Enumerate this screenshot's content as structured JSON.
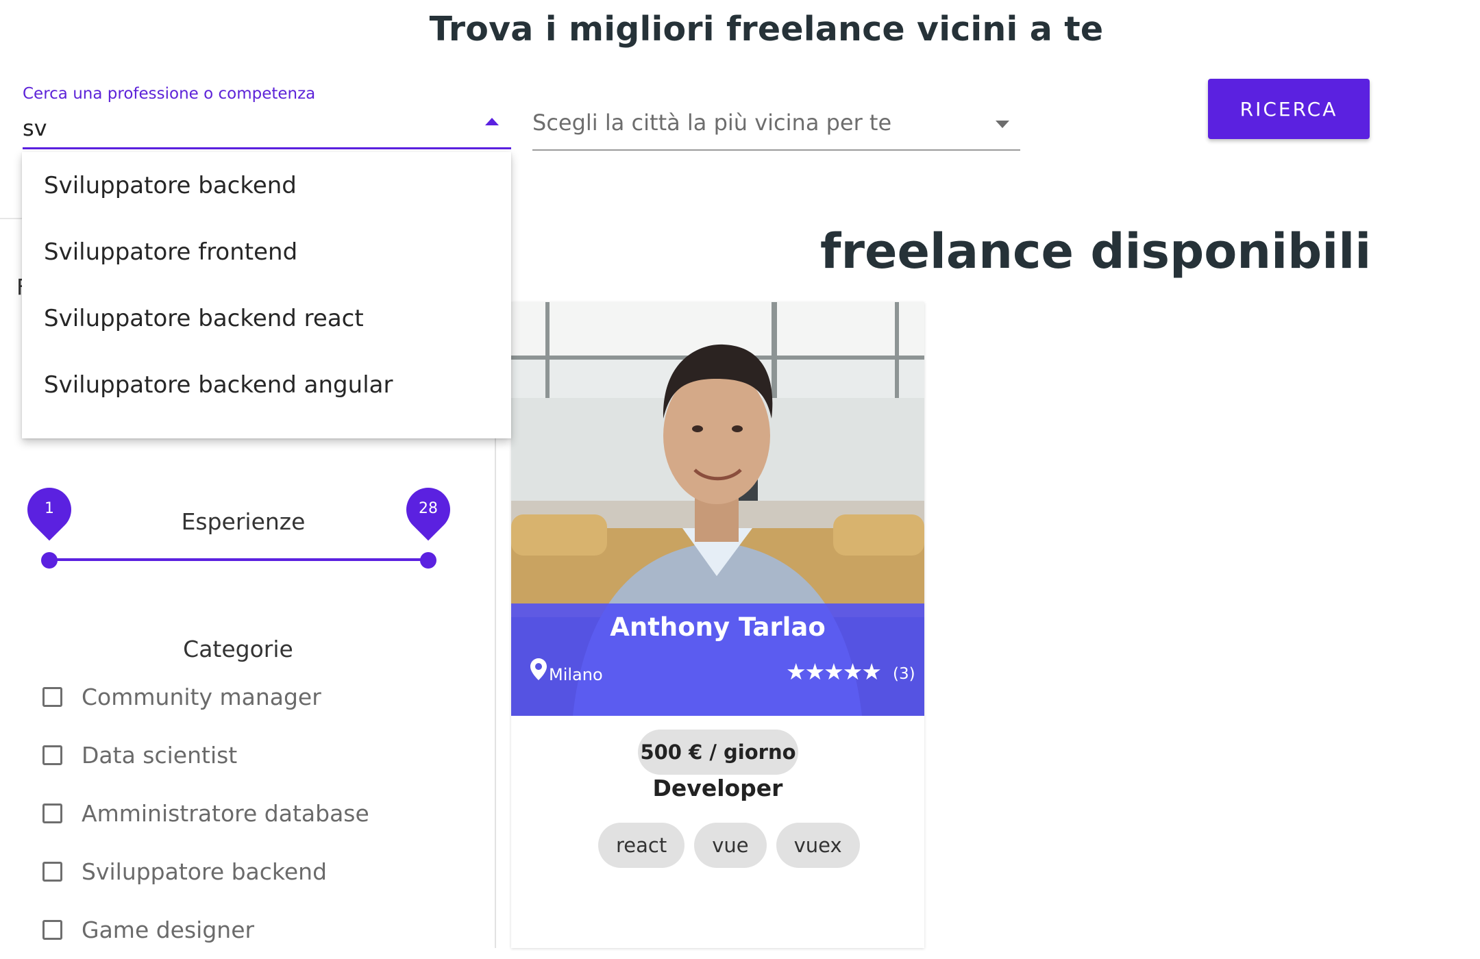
{
  "header": {
    "title": "Trova i migliori freelance vicini a te"
  },
  "search": {
    "job_label": "Cerca una professione o competenza",
    "job_value": "sv",
    "city_placeholder": "Scegli la città la più vicina per te",
    "button_label": "RICERCA",
    "suggestions": [
      "Sviluppatore backend",
      "Sviluppatore frontend",
      "Sviluppatore backend react",
      "Sviluppatore backend angular"
    ]
  },
  "filters": {
    "partial_heading": "F",
    "experience": {
      "label": "Esperienze",
      "min": "1",
      "max": "28"
    },
    "categories_title": "Categorie",
    "categories": [
      "Community manager",
      "Data scientist",
      "Amministratore database",
      "Sviluppatore backend",
      "Game designer"
    ]
  },
  "results": {
    "title": "freelance disponibili",
    "card": {
      "name": "Anthony Tarlao",
      "city": "Milano",
      "stars": "★★★★★",
      "rating_count": "(3)",
      "price": "500 € / giorno",
      "role": "Developer",
      "tags": [
        "react",
        "vue",
        "vuex"
      ]
    }
  },
  "colors": {
    "accent": "#5b21e0",
    "overlay": "#5050f5",
    "chip": "#e1e1e1"
  }
}
